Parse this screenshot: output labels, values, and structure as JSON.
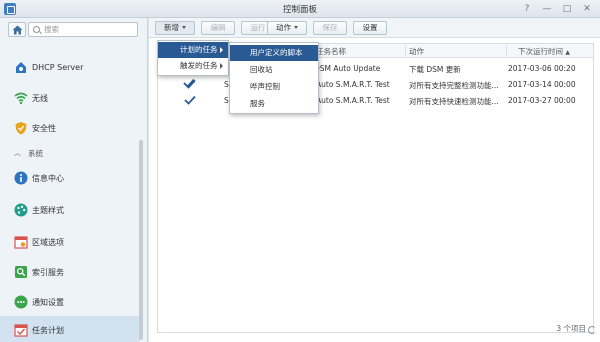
{
  "window": {
    "title": "控制面板"
  },
  "sidebar": {
    "search_placeholder": "搜索",
    "top_item": {
      "label": "DHCP Server"
    },
    "items_a": [
      {
        "label": "无线"
      },
      {
        "label": "安全性"
      }
    ],
    "section": {
      "label": "系统"
    },
    "items_b": [
      {
        "label": "信息中心"
      },
      {
        "label": "主题样式"
      },
      {
        "label": "区域选项"
      },
      {
        "label": "索引服务"
      },
      {
        "label": "通知设置"
      },
      {
        "label": "任务计划"
      }
    ]
  },
  "toolbar": {
    "create": "新增",
    "edit": "编辑",
    "run": "运行",
    "action": "动作",
    "save": "保存",
    "settings": "设置"
  },
  "grid": {
    "columns": {
      "name": "任务名称",
      "action": "动作",
      "next_run": "下次运行时间"
    },
    "rows": [
      {
        "col1": "S",
        "name": "DSM Auto Update",
        "action": "下载 DSM 更新",
        "next_run": "2017-03-06 00:20"
      },
      {
        "col1": "S",
        "name": "Auto S.M.A.R.T. Test",
        "action": "对所有支持完整检测功能...",
        "next_run": "2017-03-14 00:00"
      },
      {
        "col1": "S",
        "name": "Auto S.M.A.R.T. Test",
        "action": "对所有支持快速检测功能...",
        "next_run": "2017-03-27 00:00"
      }
    ],
    "footer_count": "3 个项目"
  },
  "menu_create": [
    {
      "label": "计划的任务"
    },
    {
      "label": "触发的任务"
    }
  ],
  "menu_scheduled": [
    {
      "label": "用户定义的脚本"
    },
    {
      "label": "回收站"
    },
    {
      "label": "哔声控制"
    },
    {
      "label": "服务"
    }
  ],
  "colors": {
    "accent": "#2a5a94",
    "sidebar_bg": "#eef3f8",
    "active_bg": "#d3e2f1"
  }
}
